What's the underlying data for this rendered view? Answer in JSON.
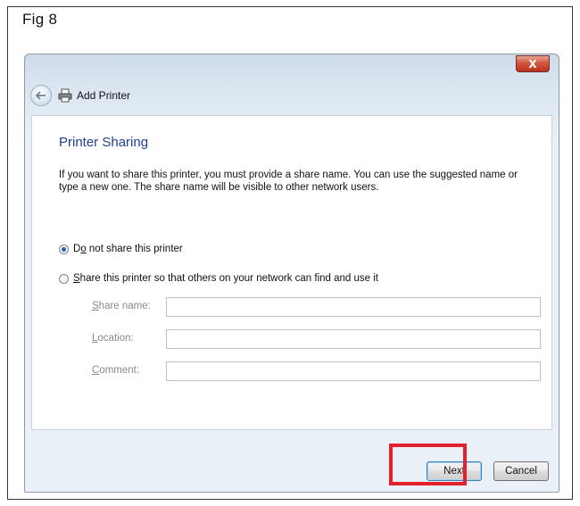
{
  "figure": {
    "label": "Fig 8"
  },
  "window": {
    "close_label": "X",
    "nav_title": "Add Printer"
  },
  "page": {
    "heading": "Printer Sharing",
    "description": "If you want to share this printer, you must provide a share name. You can use the suggested name or type a new one. The share name will be visible to other network users."
  },
  "options": {
    "do_not_share": {
      "access_key": "o",
      "label_before": "D",
      "label_after": " not share this printer",
      "selected": true
    },
    "share": {
      "access_key": "S",
      "label_after": "hare this printer so that others on your network can find and use it",
      "selected": false
    }
  },
  "fields": {
    "share_name": {
      "key": "S",
      "rest": "hare name:",
      "value": ""
    },
    "location": {
      "key": "L",
      "rest": "ocation:",
      "value": ""
    },
    "comment": {
      "key": "C",
      "rest": "omment:",
      "value": ""
    }
  },
  "buttons": {
    "next": "Next",
    "cancel": "Cancel"
  },
  "colors": {
    "highlight": "#e3202c",
    "heading": "#1e3f8f",
    "close_button": "#c8432b"
  }
}
